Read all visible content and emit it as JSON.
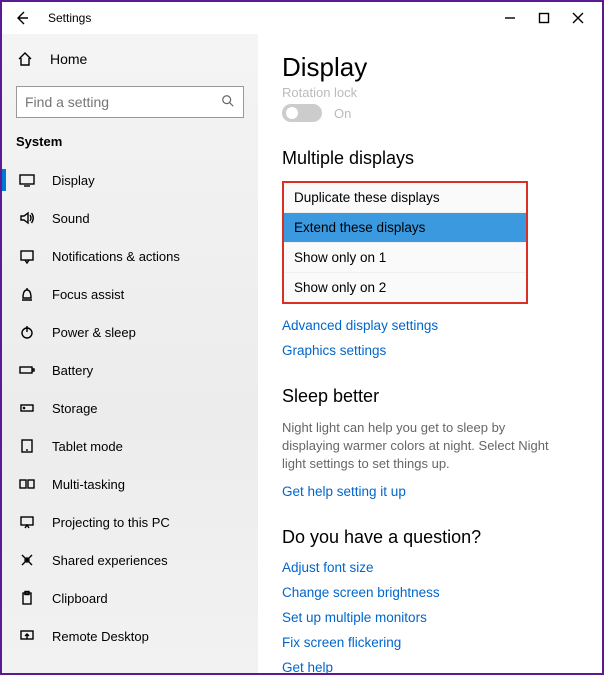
{
  "window": {
    "title": "Settings"
  },
  "sidebar": {
    "home_label": "Home",
    "search_placeholder": "Find a setting",
    "category": "System",
    "items": [
      {
        "label": "Display"
      },
      {
        "label": "Sound"
      },
      {
        "label": "Notifications & actions"
      },
      {
        "label": "Focus assist"
      },
      {
        "label": "Power & sleep"
      },
      {
        "label": "Battery"
      },
      {
        "label": "Storage"
      },
      {
        "label": "Tablet mode"
      },
      {
        "label": "Multi-tasking"
      },
      {
        "label": "Projecting to this PC"
      },
      {
        "label": "Shared experiences"
      },
      {
        "label": "Clipboard"
      },
      {
        "label": "Remote Desktop"
      }
    ]
  },
  "main": {
    "title": "Display",
    "rotation_label": "Rotation lock",
    "toggle_state": "On",
    "multiple_title": "Multiple displays",
    "display_options": [
      "Duplicate these displays",
      "Extend these displays",
      "Show only on 1",
      "Show only on 2"
    ],
    "link_advanced": "Advanced display settings",
    "link_graphics": "Graphics settings",
    "sleep_title": "Sleep better",
    "sleep_desc": "Night light can help you get to sleep by displaying warmer colors at night. Select Night light settings to set things up.",
    "sleep_link": "Get help setting it up",
    "question_title": "Do you have a question?",
    "help_links": [
      "Adjust font size",
      "Change screen brightness",
      "Set up multiple monitors",
      "Fix screen flickering",
      "Get help"
    ]
  }
}
